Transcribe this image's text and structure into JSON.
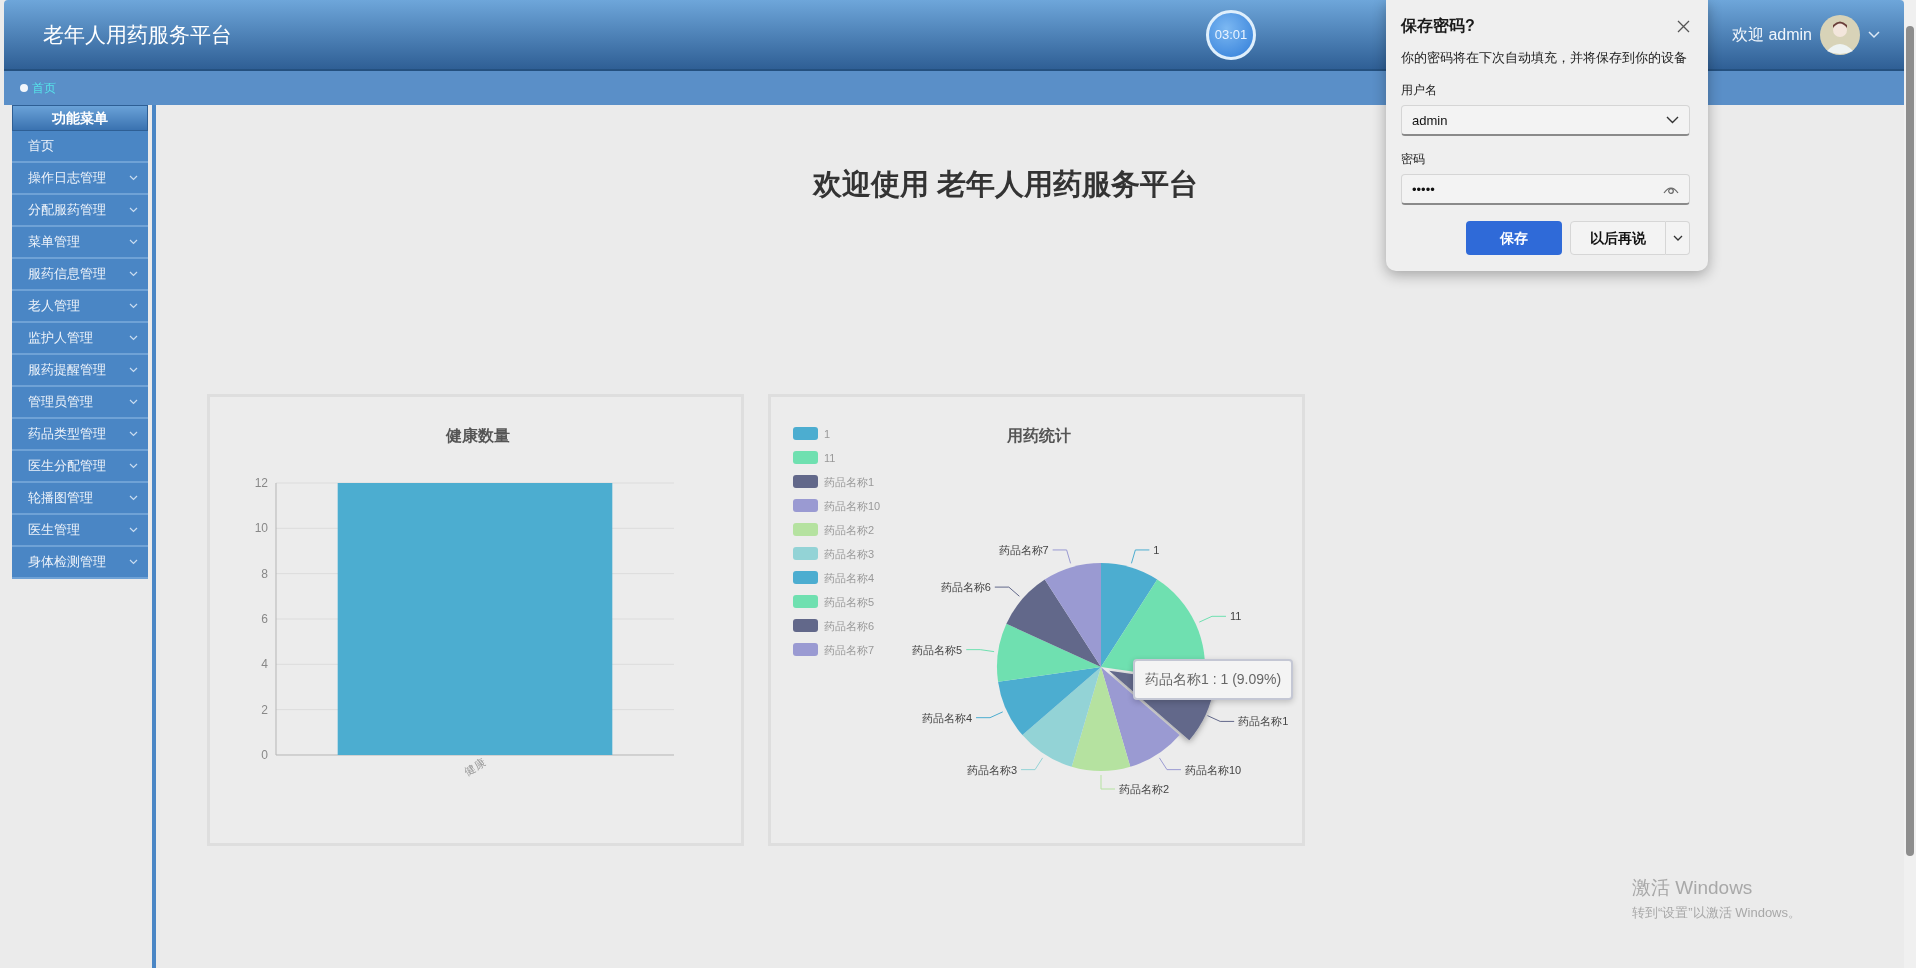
{
  "header": {
    "title": "老年人用药服务平台",
    "timer": "03:01",
    "welcome": "欢迎 admin"
  },
  "breadcrumb": [
    {
      "label": "首页"
    }
  ],
  "sidebar": {
    "title": "功能菜单",
    "items": [
      {
        "label": "首页",
        "expandable": false
      },
      {
        "label": "操作日志管理",
        "expandable": true
      },
      {
        "label": "分配服药管理",
        "expandable": true
      },
      {
        "label": "菜单管理",
        "expandable": true
      },
      {
        "label": "服药信息管理",
        "expandable": true
      },
      {
        "label": "老人管理",
        "expandable": true
      },
      {
        "label": "监护人管理",
        "expandable": true
      },
      {
        "label": "服药提醒管理",
        "expandable": true
      },
      {
        "label": "管理员管理",
        "expandable": true
      },
      {
        "label": "药品类型管理",
        "expandable": true
      },
      {
        "label": "医生分配管理",
        "expandable": true
      },
      {
        "label": "轮播图管理",
        "expandable": true
      },
      {
        "label": "医生管理",
        "expandable": true
      },
      {
        "label": "身体检测管理",
        "expandable": true
      }
    ]
  },
  "welcome_heading": "欢迎使用 老年人用药服务平台",
  "bar_chart": {
    "chart_data": {
      "type": "bar",
      "title": "健康数量",
      "categories": [
        "健康"
      ],
      "values": [
        12
      ],
      "grid": true,
      "ylim": [
        0,
        12
      ],
      "yticks": [
        0,
        2,
        4,
        6,
        8,
        10,
        12
      ]
    }
  },
  "pie_chart": {
    "legend": [
      {
        "label": "1",
        "color": "#4cadd0"
      },
      {
        "label": "11",
        "color": "#6fe0b0"
      },
      {
        "label": "药品名称1",
        "color": "#62688a"
      },
      {
        "label": "药品名称10",
        "color": "#9a9ad2"
      },
      {
        "label": "药品名称2",
        "color": "#b5e2a0"
      },
      {
        "label": "药品名称3",
        "color": "#93d3d6"
      },
      {
        "label": "药品名称4",
        "color": "#4cadd0"
      },
      {
        "label": "药品名称5",
        "color": "#6fe0b0"
      },
      {
        "label": "药品名称6",
        "color": "#62688a"
      },
      {
        "label": "药品名称7",
        "color": "#9a9ad2"
      }
    ],
    "chart_data": {
      "type": "pie",
      "title": "用药统计",
      "categories": [
        "1",
        "11",
        "药品名称1",
        "药品名称10",
        "药品名称2",
        "药品名称3",
        "药品名称4",
        "药品名称5",
        "药品名称6",
        "药品名称7"
      ],
      "values": [
        1,
        2,
        1,
        1,
        1,
        1,
        1,
        1,
        1,
        1
      ],
      "legend": "top-left",
      "annotations": [
        {
          "x": "药品名称1",
          "text": "药品名称1 : 1 (9.09%)"
        }
      ]
    }
  },
  "password_prompt": {
    "title": "保存密码?",
    "message": "你的密码将在下次自动填充，并将保存到你的设备",
    "username_label": "用户名",
    "username": "admin",
    "password_label": "密码",
    "password": "•••••",
    "save_button": "保存",
    "later_button": "以后再说"
  },
  "os_watermark": {
    "title": "激活 Windows",
    "subtitle": "转到“设置”以激活 Windows。"
  }
}
